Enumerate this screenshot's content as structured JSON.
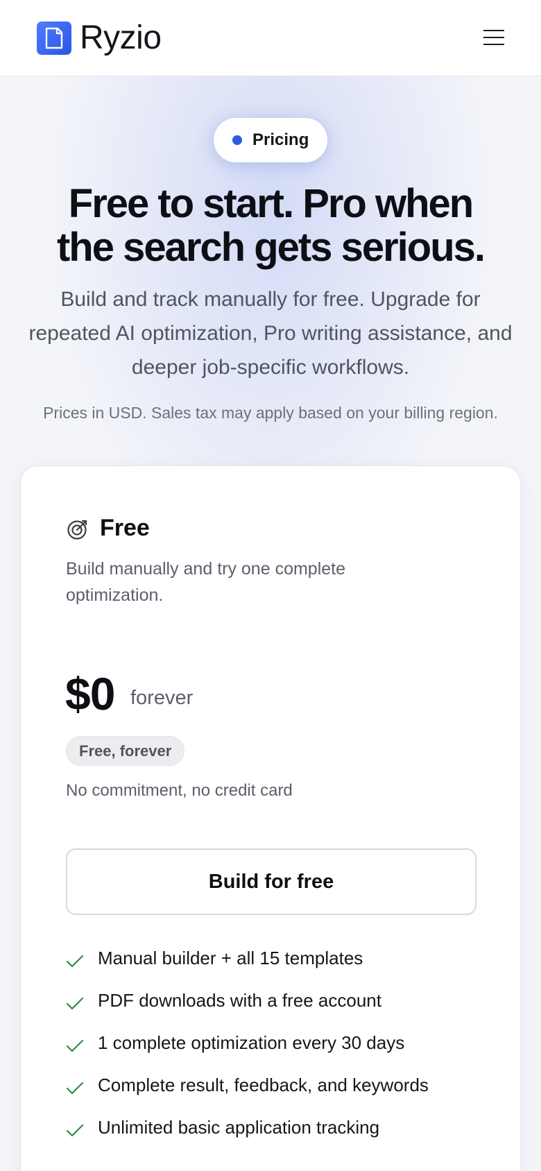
{
  "header": {
    "brand": "Ryzio",
    "logo_icon": "document-icon",
    "menu_icon": "hamburger-menu-icon"
  },
  "hero": {
    "pill_label": "Pricing",
    "headline_line1": "Free to start. Pro when",
    "headline_line2": "the search gets serious.",
    "subtitle": "Build and track manually for free. Upgrade for repeated AI optimization, Pro writing assistance, and deeper job-specific workflows.",
    "note": "Prices in USD. Sales tax may apply based on your billing region."
  },
  "plan": {
    "icon": "target-icon",
    "name": "Free",
    "description": "Build manually and try one complete optimization.",
    "price": "$0",
    "period": "forever",
    "badge": "Free, forever",
    "commitment": "No commitment, no credit card",
    "cta_label": "Build for free",
    "features": [
      "Manual builder + all 15 templates",
      "PDF downloads with a free account",
      "1 complete optimization every 30 days",
      "Complete result, feedback, and keywords",
      "Unlimited basic application tracking"
    ]
  },
  "colors": {
    "accent": "#2d5be0",
    "check": "#2f8a4c",
    "text": "#0d0f14",
    "muted": "#5a5f6a"
  }
}
